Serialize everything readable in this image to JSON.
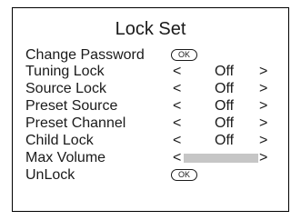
{
  "title": "Lock Set",
  "ok_label": "OK",
  "arrow_left": "<",
  "arrow_right": ">",
  "rows": [
    {
      "label": "Change Password"
    },
    {
      "label": "Tuning Lock",
      "value": "Off"
    },
    {
      "label": "Source Lock",
      "value": "Off"
    },
    {
      "label": "Preset Source",
      "value": "Off"
    },
    {
      "label": "Preset Channel",
      "value": "Off"
    },
    {
      "label": "Child Lock",
      "value": "Off"
    },
    {
      "label": "Max Volume"
    },
    {
      "label": "UnLock"
    }
  ],
  "colors": {
    "bar": "#c6c6c6",
    "border": "#000000",
    "text": "#1a1a1a"
  }
}
